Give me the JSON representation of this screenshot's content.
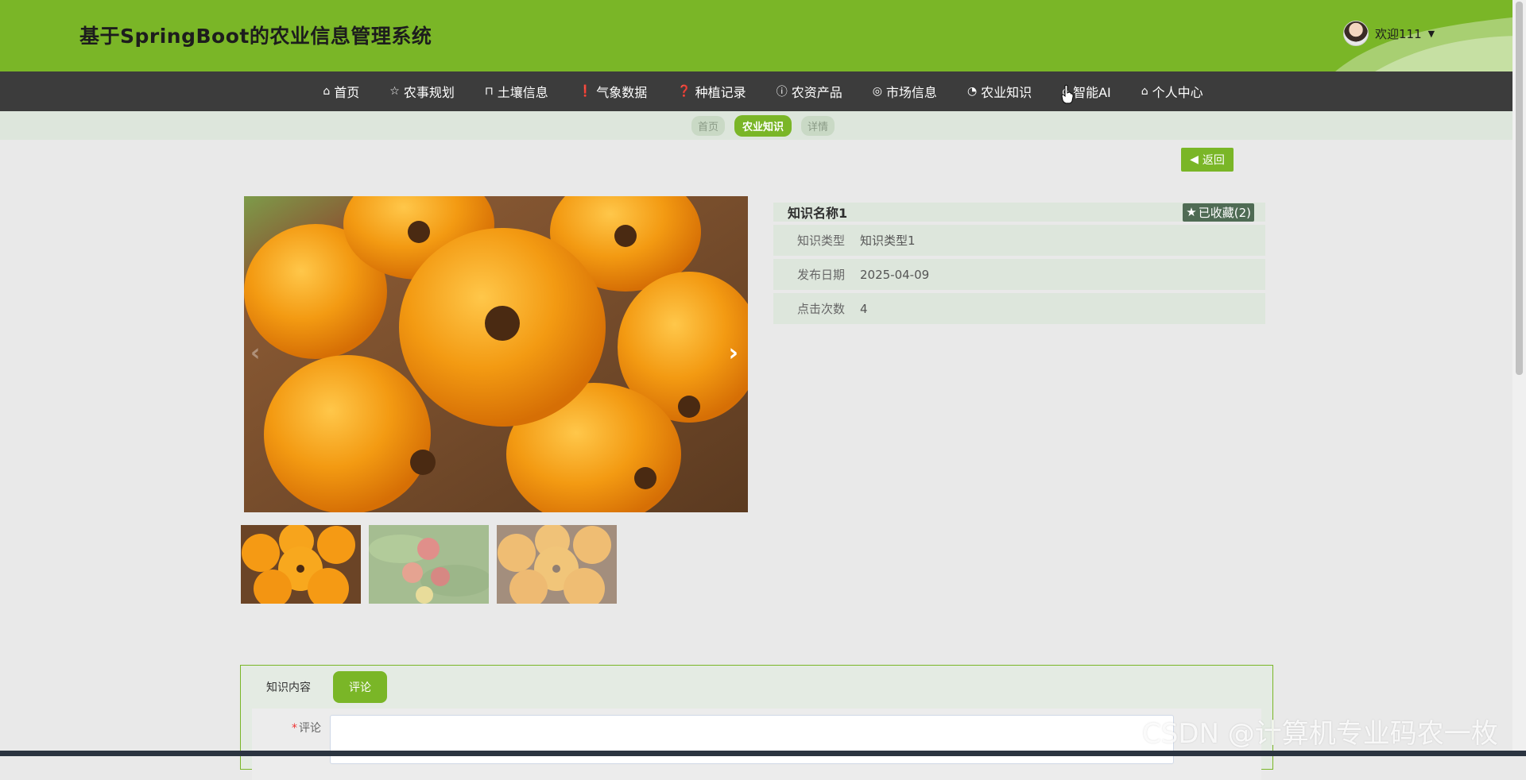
{
  "header": {
    "title": "基于SpringBoot的农业信息管理系统",
    "welcome": "欢迎111"
  },
  "nav": {
    "items": [
      {
        "label": "首页",
        "icon": "home-icon",
        "glyph": "⌂"
      },
      {
        "label": "农事规划",
        "icon": "star-icon",
        "glyph": "☆"
      },
      {
        "label": "土壤信息",
        "icon": "bag-icon",
        "glyph": "⊓"
      },
      {
        "label": "气象数据",
        "icon": "alert-icon",
        "glyph": "❗"
      },
      {
        "label": "种植记录",
        "icon": "question-icon",
        "glyph": "❓"
      },
      {
        "label": "农资产品",
        "icon": "info-icon",
        "glyph": "ⓘ"
      },
      {
        "label": "市场信息",
        "icon": "target-icon",
        "glyph": "◎"
      },
      {
        "label": "农业知识",
        "icon": "gauge-icon",
        "glyph": "◔"
      },
      {
        "label": "智能AI",
        "icon": "home-icon",
        "glyph": "⌂"
      },
      {
        "label": "个人中心",
        "icon": "home-icon",
        "glyph": "⌂"
      }
    ]
  },
  "breadcrumb": {
    "items": [
      "首页",
      "农业知识",
      "详情"
    ],
    "active_index": 1
  },
  "back_label": "返回",
  "detail": {
    "title": "知识名称1",
    "favorite_label": "已收藏(2)",
    "rows": [
      {
        "key": "知识类型",
        "value": "知识类型1"
      },
      {
        "key": "发布日期",
        "value": "2025-04-09"
      },
      {
        "key": "点击次数",
        "value": "4"
      }
    ]
  },
  "tabs": {
    "items": [
      "知识内容",
      "评论"
    ],
    "active_index": 1
  },
  "comment_form": {
    "label": "评论",
    "value": ""
  },
  "watermark": "CSDN @计算机专业码农一枚",
  "colors": {
    "brand_green": "#7ab627",
    "nav_dark": "#3c3c3c",
    "strip": "#dde6dc"
  }
}
